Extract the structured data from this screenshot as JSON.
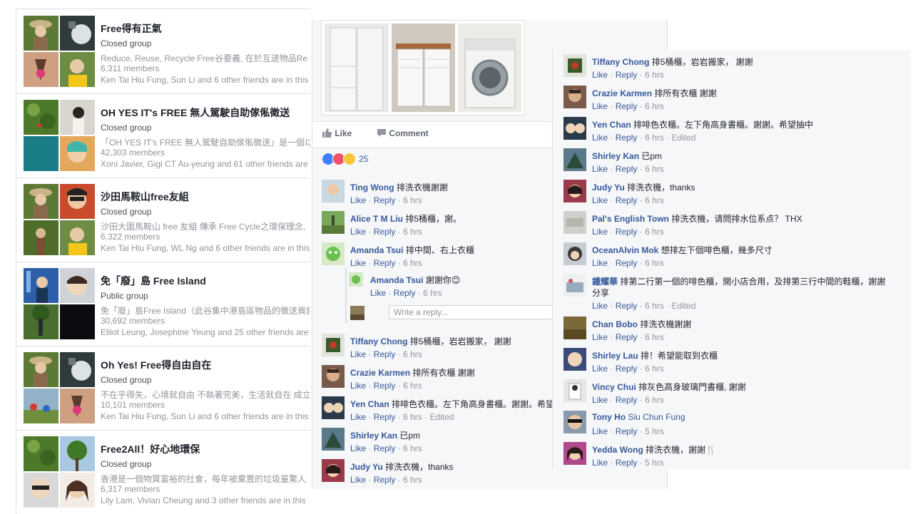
{
  "groups": [
    {
      "name": "Free得有正氣",
      "type": "Closed group",
      "desc": "Reduce, Reuse, Recycle Free谷要義, 在於互送物品Re",
      "members": "6,311 members",
      "friends": "Ken Tai Hiu Fung, Sun Li and 6 other friends are in this"
    },
    {
      "name": "OH YES IT's FREE 無人駕駛自助傢俬徵送",
      "type": "Closed group",
      "desc": "「OH YES IT's FREE 無人駕駛自助傢俬徵送」是一個以",
      "members": "42,303 members",
      "friends": "Xoni Javier, Gigi CT Au-yeung and 61 other friends are in"
    },
    {
      "name": "沙田馬鞍山free友組",
      "type": "Closed group",
      "desc": "沙田大圍馬鞍山 free 友組 傳承 Free Cycle之環保理念,",
      "members": "6,322 members",
      "friends": "Ken Tai Hiu Fung, WL Ng and 6 other friends are in this"
    },
    {
      "name": "免「廢」島 Free Island",
      "type": "Public group",
      "desc": "免「廢」島Free Island（此谷集中港島區物品的徵送資訊",
      "members": "30,692 members",
      "friends": "Elliot Leung, Josephine Yeung and 25 other friends are"
    },
    {
      "name": "Oh Yes! Free得自由自在",
      "type": "Closed group",
      "desc": "不在乎得失，心境就自由 不執著完美，生活就自在 成立",
      "members": "10,101 members",
      "friends": "Ken Tai Hiu Fung, Sun Li and 6 other friends are in this"
    },
    {
      "name": "Free2All！好心地環保",
      "type": "Closed group",
      "desc": "香港是一個物質富裕的社會，每年被棄置的垃圾量驚人",
      "members": "6,317 members",
      "friends": "Lily Lam, Vivian Cheung and 3 other friends are in this"
    }
  ],
  "post": {
    "like_label": "Like",
    "comment_label": "Comment",
    "reaction_count": "25",
    "reply_placeholder": "Write a reply...",
    "comments": [
      {
        "name": "Ting Wong",
        "text": "排洗衣機謝謝",
        "like": "Like",
        "reply": "Reply",
        "time": "6 hrs",
        "edited": ""
      },
      {
        "name": "Alice T M Liu",
        "text": "排5桶櫃，謝。",
        "like": "Like",
        "reply": "Reply",
        "time": "6 hrs",
        "edited": ""
      },
      {
        "name": "Amanda Tsui",
        "text": "排中間、右上衣櫃",
        "like": "Like",
        "reply": "Reply",
        "time": "6 hrs",
        "edited": ""
      },
      {
        "name": "Amanda Tsui",
        "text": "謝謝你😊",
        "like": "Like",
        "reply": "Reply",
        "time": "6 hrs",
        "edited": ""
      },
      {
        "name": "Tiffany Chong",
        "text": "排5桶櫃，岩岩搬家， 謝謝",
        "like": "Like",
        "reply": "Reply",
        "time": "6 hrs",
        "edited": ""
      },
      {
        "name": "Crazie Karmen",
        "text": "排所有衣櫃 謝謝",
        "like": "Like",
        "reply": "Reply",
        "time": "6 hrs",
        "edited": ""
      },
      {
        "name": "Yen Chan",
        "text": "排啡色衣櫃。左下角高身書櫃。謝謝。希望",
        "like": "Like",
        "reply": "Reply",
        "time": "6 hrs",
        "edited": "Edited"
      },
      {
        "name": "Shirley Kan",
        "text": "已pm",
        "like": "Like",
        "reply": "Reply",
        "time": "6 hrs",
        "edited": ""
      },
      {
        "name": "Judy Yu",
        "text": "排洗衣機，thanks",
        "like": "Like",
        "reply": "Reply",
        "time": "6 hrs",
        "edited": ""
      }
    ]
  },
  "comments2": [
    {
      "name": "Tiffany Chong",
      "text": "排5桶櫃，岩岩搬家， 謝謝",
      "like": "Like",
      "reply": "Reply",
      "time": "6 hrs",
      "edited": ""
    },
    {
      "name": "Crazie Karmen",
      "text": "排所有衣櫃 謝謝",
      "like": "Like",
      "reply": "Reply",
      "time": "6 hrs",
      "edited": ""
    },
    {
      "name": "Yen Chan",
      "text": "排啡色衣櫃。左下角高身書櫃。謝謝。希望抽中",
      "like": "Like",
      "reply": "Reply",
      "time": "6 hrs",
      "edited": "Edited"
    },
    {
      "name": "Shirley Kan",
      "text": "已pm",
      "like": "Like",
      "reply": "Reply",
      "time": "6 hrs",
      "edited": ""
    },
    {
      "name": "Judy Yu",
      "text": "排洗衣機，thanks",
      "like": "Like",
      "reply": "Reply",
      "time": "6 hrs",
      "edited": ""
    },
    {
      "name": "Pal's English Town",
      "text": "排洗衣機，请問排水位系点？ THX",
      "like": "Like",
      "reply": "Reply",
      "time": "6 hrs",
      "edited": ""
    },
    {
      "name": "OceanAlvin Mok",
      "text": "想排左下個啡色櫃，幾多尺寸",
      "like": "Like",
      "reply": "Reply",
      "time": "6 hrs",
      "edited": ""
    },
    {
      "name": "鍾耀華",
      "text": "排第二行第一個的啡色櫃，開小店合用，及排第三行中間的鞋櫃，謝謝",
      "text2": "分享",
      "like": "Like",
      "reply": "Reply",
      "time": "6 hrs",
      "edited": "Edited"
    },
    {
      "name": "Chan Bobo",
      "text": "排洗衣機謝謝",
      "like": "Like",
      "reply": "Reply",
      "time": "6 hrs",
      "edited": ""
    },
    {
      "name": "Shirley Lau",
      "text": "排！希望能取到衣櫃",
      "like": "Like",
      "reply": "Reply",
      "time": "6 hrs",
      "edited": ""
    },
    {
      "name": "Vincy Chui",
      "text": "排灰色高身玻璃門書櫃, 謝謝",
      "like": "Like",
      "reply": "Reply",
      "time": "6 hrs",
      "edited": ""
    },
    {
      "name": "Tony Ho",
      "text": "Siu Chun Fung",
      "like": "Like",
      "reply": "Reply",
      "time": "5 hrs",
      "edited": ""
    },
    {
      "name": "Yedda Wong",
      "text": "排洗衣機，謝謝🍴",
      "like": "Like",
      "reply": "Reply",
      "time": "5 hrs",
      "edited": ""
    }
  ],
  "separators": {
    "dot": "·"
  }
}
